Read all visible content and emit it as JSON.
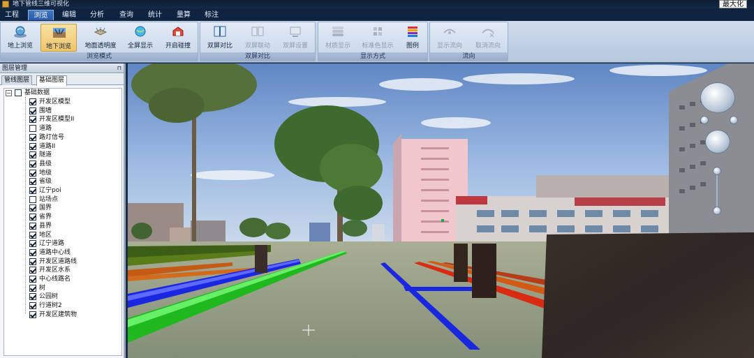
{
  "window": {
    "title": "地下管线三维可视化",
    "maximize_label": "最大化"
  },
  "menu": {
    "items": [
      "工程",
      "浏览",
      "编辑",
      "分析",
      "查询",
      "统计",
      "量算",
      "标注"
    ],
    "active_index": 1
  },
  "ribbon": {
    "groups": [
      {
        "caption": "浏览模式",
        "buttons": [
          {
            "label": "地上浏览",
            "icon": "above-ground-icon",
            "state": "normal"
          },
          {
            "label": "地下浏览",
            "icon": "underground-icon",
            "state": "selected"
          },
          {
            "label": "地面透明度",
            "icon": "ground-transparency-icon",
            "state": "normal"
          },
          {
            "label": "全屏显示",
            "icon": "fullscreen-globe-icon",
            "state": "normal"
          },
          {
            "label": "开启碰撞",
            "icon": "collision-icon",
            "state": "normal"
          }
        ]
      },
      {
        "caption": "双屏对比",
        "buttons": [
          {
            "label": "双屏对比",
            "icon": "split-screen-icon",
            "state": "normal"
          },
          {
            "label": "双屏联动",
            "icon": "linked-screens-icon",
            "state": "disabled"
          },
          {
            "label": "双屏设置",
            "icon": "screen-settings-icon",
            "state": "disabled"
          }
        ]
      },
      {
        "caption": "显示方式",
        "buttons": [
          {
            "label": "材质显示",
            "icon": "material-icon",
            "state": "disabled"
          },
          {
            "label": "标准色显示",
            "icon": "standard-color-icon",
            "state": "disabled"
          },
          {
            "label": "图例",
            "icon": "legend-icon",
            "state": "normal"
          }
        ]
      },
      {
        "caption": "流向",
        "buttons": [
          {
            "label": "显示流向",
            "icon": "show-flow-icon",
            "state": "disabled"
          },
          {
            "label": "取消流向",
            "icon": "cancel-flow-icon",
            "state": "disabled"
          }
        ]
      }
    ]
  },
  "layer_panel": {
    "title": "图层管理",
    "tabs": [
      "管线图层",
      "基础图层"
    ],
    "active_tab": 1,
    "root": {
      "label": "基础数据",
      "expanded": true,
      "checked": false
    },
    "items": [
      {
        "label": "开发区模型",
        "checked": true
      },
      {
        "label": "围墙",
        "checked": true
      },
      {
        "label": "开发区模型II",
        "checked": true
      },
      {
        "label": "道路",
        "checked": false
      },
      {
        "label": "路灯信号",
        "checked": true
      },
      {
        "label": "道路II",
        "checked": true
      },
      {
        "label": "隧道",
        "checked": true
      },
      {
        "label": "县级",
        "checked": true
      },
      {
        "label": "地级",
        "checked": true
      },
      {
        "label": "省级",
        "checked": true
      },
      {
        "label": "辽宁poi",
        "checked": true
      },
      {
        "label": "站场点",
        "checked": false
      },
      {
        "label": "国界",
        "checked": true
      },
      {
        "label": "省界",
        "checked": true
      },
      {
        "label": "县界",
        "checked": true
      },
      {
        "label": "地区",
        "checked": true
      },
      {
        "label": "辽宁道路",
        "checked": true
      },
      {
        "label": "道路中心线",
        "checked": true
      },
      {
        "label": "开发区道路线",
        "checked": true
      },
      {
        "label": "开发区水系",
        "checked": true
      },
      {
        "label": "中心线路名",
        "checked": true
      },
      {
        "label": "树",
        "checked": true
      },
      {
        "label": "公园树",
        "checked": true
      },
      {
        "label": "行道树2",
        "checked": true
      },
      {
        "label": "开发区建筑物",
        "checked": true
      }
    ]
  },
  "colors": {
    "pipe_green": "#1fd31f",
    "pipe_blue": "#1a27e0",
    "pipe_red": "#d92b12",
    "pipe_orange": "#d25a12",
    "ribbon_selected": "#efc56b"
  }
}
